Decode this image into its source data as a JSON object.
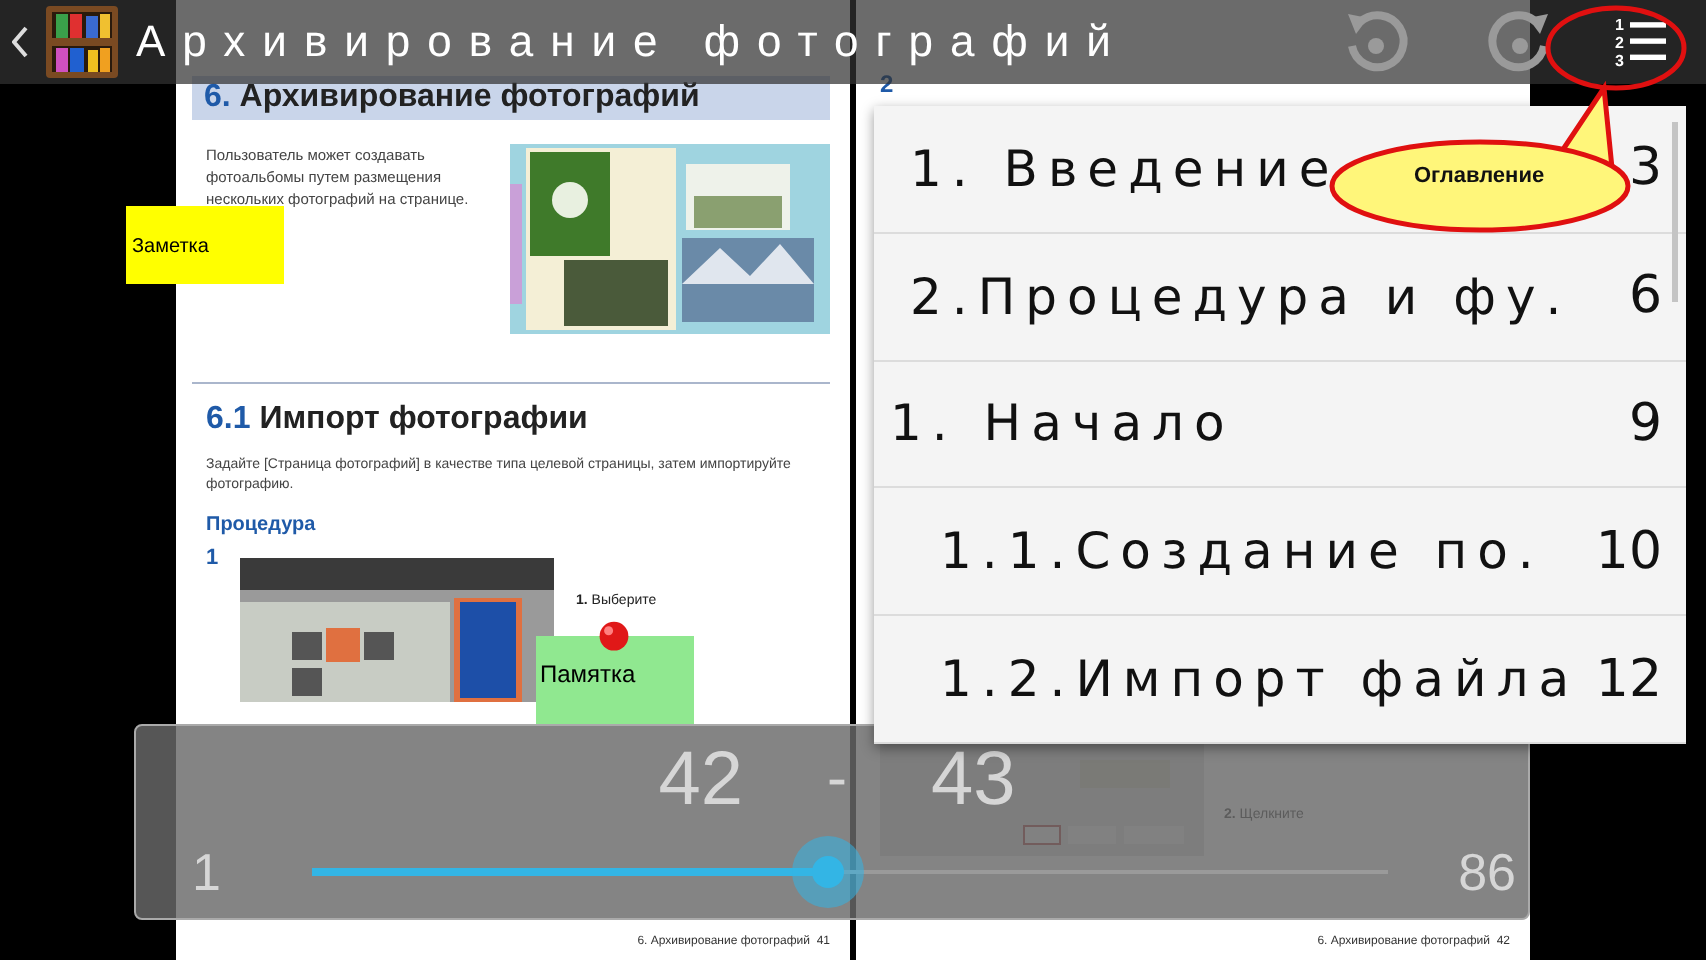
{
  "top_bar": {
    "title": "Архивирование фотографий",
    "contents_digits": [
      "1",
      "2",
      "3"
    ]
  },
  "left_page": {
    "heading_number": "6.",
    "heading": "Архивирование фотографий",
    "intro": "Пользователь может создавать фотоальбомы путем размещения нескольких фотографий на странице.",
    "section_number": "6.1",
    "section_title": "Импорт фотографии",
    "section_text": "Задайте [Страница фотографий] в качестве типа целевой страницы, затем импортируйте фотографию.",
    "procedure": "Процедура",
    "step": "1",
    "step_callout": "**1.** Выберите",
    "footer_title": "6. Архивирование фотографий",
    "footer_page": "41"
  },
  "right_page": {
    "step": "2",
    "step_callout": "**2.** Щелкните",
    "footer_title": "6. Архивирование фотографий",
    "footer_page": "42"
  },
  "notes": [
    {
      "text": "Заметка",
      "color": "#ffff00",
      "kind": "plain"
    },
    {
      "text": "Памятка",
      "color": "#90e890",
      "kind": "pinned"
    }
  ],
  "page_slider": {
    "from": "42",
    "separator": "-",
    "to": "43",
    "min": "1",
    "max": "86",
    "level": 0.48
  },
  "toc": [
    {
      "label": "1. Введение",
      "page": "3"
    },
    {
      "label": "2.Процедура и фу.",
      "page": "6"
    },
    {
      "label": "1.  Начало",
      "page": "9",
      "children": [
        {
          "label": "1.1.Создание по.",
          "page": "10"
        },
        {
          "label": "1.2.Импорт файла",
          "page": "12"
        }
      ]
    }
  ],
  "toc_callout": "Оглавление"
}
